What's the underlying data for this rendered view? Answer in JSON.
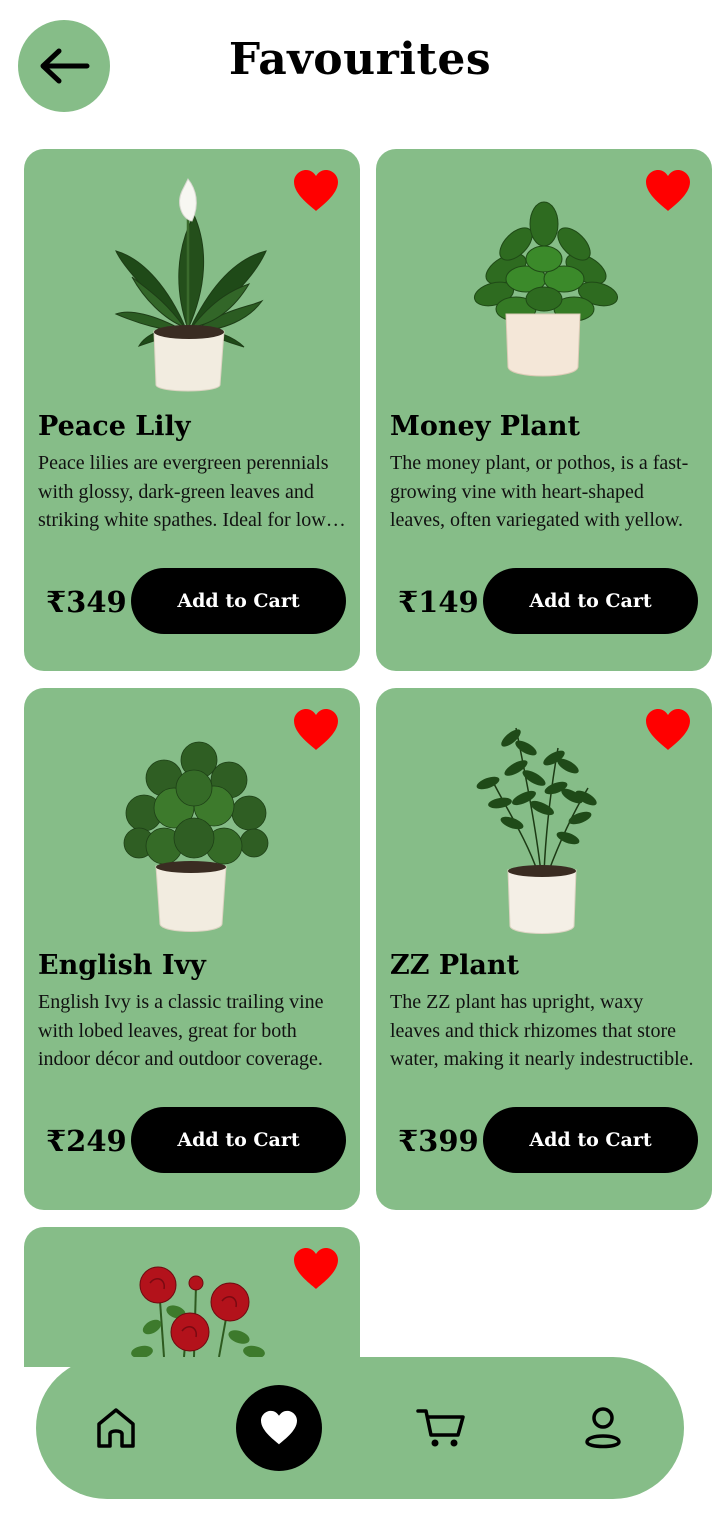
{
  "header": {
    "title": "Favourites",
    "back_icon": "arrow-left-icon"
  },
  "colors": {
    "card_bg": "#86bd88",
    "heart": "#ff0000",
    "button_bg": "#000000",
    "button_text": "#ffffff"
  },
  "products": [
    {
      "name": "Peace Lily",
      "description": "Peace lilies are evergreen perennials with glossy, dark-green leaves and striking white spathes. Ideal for low light.",
      "price": "₹349",
      "cart_label": "Add to Cart",
      "favourite_icon": "heart-icon"
    },
    {
      "name": "Money Plant",
      "description": "The money plant, or pothos, is a fast-growing vine with heart-shaped leaves, often variegated with yellow.",
      "price": "₹149",
      "cart_label": "Add to Cart",
      "favourite_icon": "heart-icon"
    },
    {
      "name": "English Ivy",
      "description": "English Ivy is a classic trailing vine with lobed leaves, great for both indoor décor and outdoor coverage.",
      "price": "₹249",
      "cart_label": "Add to Cart",
      "favourite_icon": "heart-icon"
    },
    {
      "name": "ZZ Plant",
      "description": "The ZZ plant has upright, waxy leaves and thick rhizomes that store water, making it nearly indestructible.",
      "price": "₹399",
      "cart_label": "Add to Cart",
      "favourite_icon": "heart-icon"
    }
  ],
  "bottom_nav": {
    "items": [
      "home-icon",
      "heart-icon",
      "cart-icon",
      "profile-icon"
    ],
    "active": "heart-icon"
  }
}
